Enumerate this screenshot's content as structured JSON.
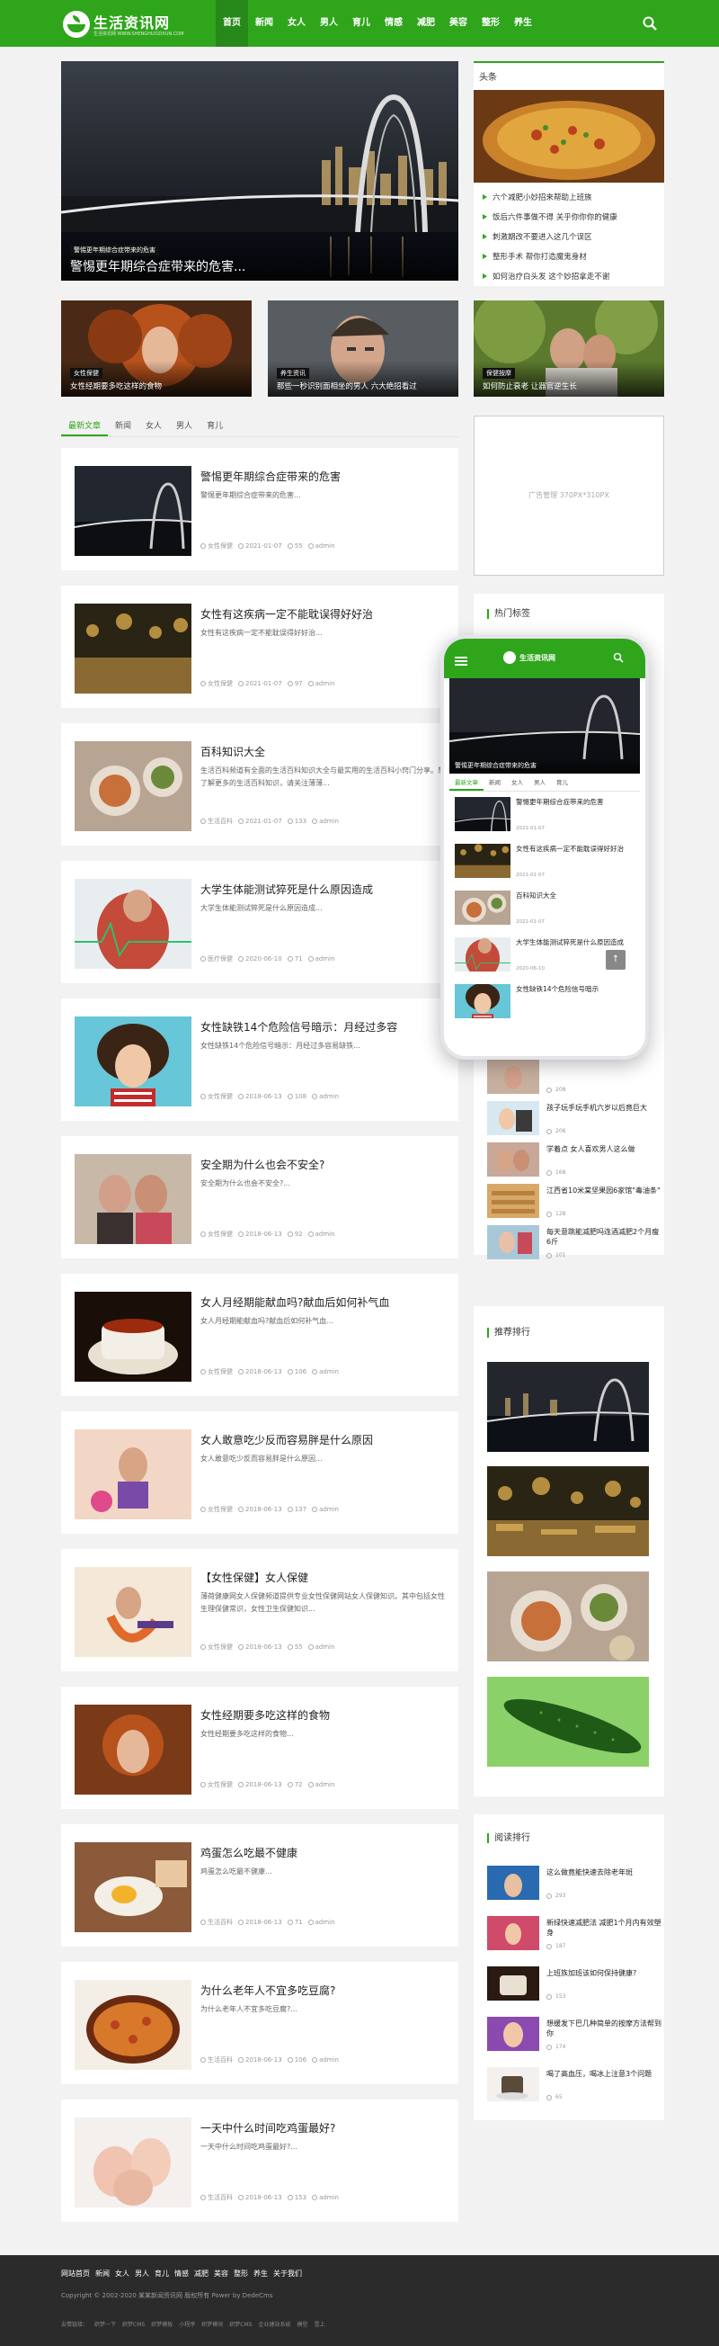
{
  "site": {
    "logo_text": "生活资讯网",
    "logo_sub": "生活资讯网 WWW.SHENGHUOZIXUN.COM"
  },
  "nav": [
    "首页",
    "新闻",
    "女人",
    "男人",
    "育儿",
    "情感",
    "减肥",
    "美容",
    "整形",
    "养生"
  ],
  "hero": {
    "tag": "警惕更年期综合症带来的危害",
    "caption": "警惕更年期综合症带来的危害..."
  },
  "banners": [
    {
      "tag": "女性保健",
      "caption": "女性经期要多吃这样的食物"
    },
    {
      "tag": "养生资讯",
      "caption": "那些一秒识别面相坐的男人 六大绝招看过"
    },
    {
      "tag": "保健按摩",
      "caption": "如何防止衰老 让器官逆生长"
    }
  ],
  "headlines": {
    "title": "头条",
    "items": [
      "六个减肥小妙招来帮助上班族",
      "饭后六件事做不得 关乎你你你的健康",
      "刺激期改不要进入这几个误区",
      "整形手术 帮你打造魔鬼身材",
      "如何治疗白头发 这个妙招拿走不谢"
    ]
  },
  "ad": {
    "text": "广告管理 370PX*310PX"
  },
  "tabs": [
    "最新文章",
    "新闻",
    "女人",
    "男人",
    "育儿"
  ],
  "articles": [
    {
      "title": "警惕更年期综合症带来的危害",
      "desc": "警惕更年期综合症带来的危害...",
      "cat": "女性保健",
      "date": "2021-01-07",
      "views": "55",
      "author": "admin"
    },
    {
      "title": "女性有这疾病一定不能耽误得好好治",
      "desc": "女性有这疾病一定不能耽误得好好治...",
      "cat": "女性保健",
      "date": "2021-01-07",
      "views": "97",
      "author": "admin"
    },
    {
      "title": "百科知识大全",
      "desc": "生活百科频道有全面的生活百科知识大全与最实用的生活百科小窍门分享。想了解更多的生活百科知识，请关注薄薄...",
      "cat": "生活百科",
      "date": "2021-01-07",
      "views": "133",
      "author": "admin"
    },
    {
      "title": "大学生体能测试猝死是什么原因造成",
      "desc": "大学生体能测试猝死是什么原因造成...",
      "cat": "医疗保健",
      "date": "2020-06-10",
      "views": "71",
      "author": "admin"
    },
    {
      "title": "女性缺铁14个危险信号暗示：月经过多容",
      "desc": "女性缺铁14个危险信号暗示：月经过多容易缺铁...",
      "cat": "女性保健",
      "date": "2018-06-13",
      "views": "108",
      "author": "admin"
    },
    {
      "title": "安全期为什么也会不安全?",
      "desc": "安全期为什么也会不安全?...",
      "cat": "女性保健",
      "date": "2018-06-13",
      "views": "92",
      "author": "admin"
    },
    {
      "title": "女人月经期能献血吗?献血后如何补气血",
      "desc": "女人月经期能献血吗?献血后如何补气血...",
      "cat": "女性保健",
      "date": "2018-06-13",
      "views": "106",
      "author": "admin"
    },
    {
      "title": "女人敢意吃少反而容易胖是什么原因",
      "desc": "女人敢意吃少反而容易胖是什么原因...",
      "cat": "女性保健",
      "date": "2018-06-13",
      "views": "137",
      "author": "admin"
    },
    {
      "title": "【女性保健】女人保健",
      "desc": "薄荷健康网女人保健频道提供专业女性保健网站女人保健知识。其中包括女性生理保健常识，女性卫生保健知识...",
      "cat": "女性保健",
      "date": "2018-06-13",
      "views": "55",
      "author": "admin"
    },
    {
      "title": "女性经期要多吃这样的食物",
      "desc": "女性经期要多吃这样的食物...",
      "cat": "女性保健",
      "date": "2018-06-13",
      "views": "72",
      "author": "admin"
    },
    {
      "title": "鸡蛋怎么吃最不健康",
      "desc": "鸡蛋怎么吃最不健康...",
      "cat": "生活百科",
      "date": "2018-06-13",
      "views": "71",
      "author": "admin"
    },
    {
      "title": "为什么老年人不宜多吃豆腐?",
      "desc": "为什么老年人不宜多吃豆腐?...",
      "cat": "生活百科",
      "date": "2018-06-13",
      "views": "106",
      "author": "admin"
    },
    {
      "title": "一天中什么时间吃鸡蛋最好?",
      "desc": "一天中什么时间吃鸡蛋最好?...",
      "cat": "生活百科",
      "date": "2018-06-13",
      "views": "153",
      "author": "admin"
    }
  ],
  "hot_tags": {
    "title": "热门标签"
  },
  "phone": {
    "logo_text": "生活资讯网",
    "hero_caption": "警惕更年期综合症带来的危害",
    "tabs": [
      "最新文章",
      "新闻",
      "女人",
      "男人",
      "育儿"
    ],
    "items": [
      {
        "title": "警惕更年期综合症带来的危害",
        "date": "2021-01-07"
      },
      {
        "title": "女性有这疾病一定不能耽误得好好治",
        "date": "2021-01-07"
      },
      {
        "title": "百科知识大全",
        "date": "2021-01-07"
      },
      {
        "title": "大学生体能测试猝死是什么原因造成",
        "date": "2020-06-10"
      },
      {
        "title": "女性缺铁14个危险信号暗示",
        "date": ""
      }
    ]
  },
  "side_list": [
    {
      "title": "",
      "views": "208"
    },
    {
      "title": "孩子玩手玩手机六岁以后竟巨大",
      "views": "206"
    },
    {
      "title": "学着点 女人喜欢男人这么做",
      "views": "168"
    },
    {
      "title": "江西省10米棠坚果园6家馆\"毒油条\"",
      "views": "128"
    },
    {
      "title": "每天意跳能减肥吗连酒减肥2个月瘦6斤",
      "views": "101"
    }
  ],
  "ranking": {
    "title": "推荐排行"
  },
  "reading": {
    "title": "阅读排行",
    "items": [
      {
        "title": "这么做竟能快速去除老年斑",
        "views": "293"
      },
      {
        "title": "新绿快速减肥法 减肥1个月内有效塑身",
        "views": "187"
      },
      {
        "title": "上班族加班该如何保持健康?",
        "views": "153"
      },
      {
        "title": "想缓发下巴几种简单的按摩方法帮到你",
        "views": "174"
      },
      {
        "title": "喝了高血压，喝冰上注意3个问题",
        "views": "65"
      }
    ]
  },
  "footer": {
    "nav": [
      "网站首页",
      "新闻",
      "女人",
      "男人",
      "育儿",
      "情感",
      "减肥",
      "美容",
      "整形",
      "养生",
      "关于我们"
    ],
    "copyright": "Copyright © 2002-2020 某某新闻资讯网 版权所有 Power by DedeCms",
    "links_label": "友情链接：",
    "links": [
      "织梦一下",
      "织梦CMS",
      "织梦模板",
      "小程序",
      "织梦模块",
      "织梦CMS",
      "企业建站系统",
      "模型",
      "雪上"
    ]
  },
  "colors": {
    "brand": "#2fa51c",
    "footer": "#2b2b2b"
  }
}
